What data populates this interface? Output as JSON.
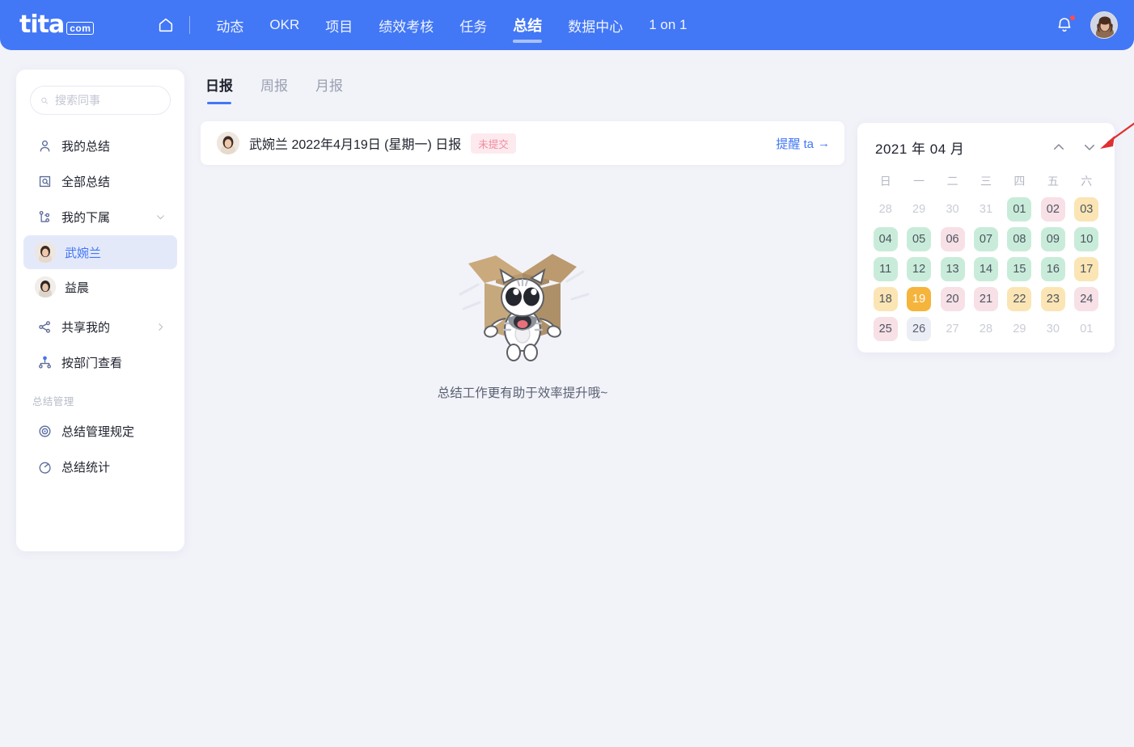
{
  "header": {
    "logo_word": "tita",
    "logo_com": "com",
    "home_icon": "home-icon",
    "bell_icon": "bell-icon",
    "avatar": "user-avatar",
    "nav": [
      {
        "label": "动态",
        "active": false
      },
      {
        "label": "OKR",
        "active": false
      },
      {
        "label": "项目",
        "active": false
      },
      {
        "label": "绩效考核",
        "active": false
      },
      {
        "label": "任务",
        "active": false
      },
      {
        "label": "总结",
        "active": true
      },
      {
        "label": "数据中心",
        "active": false
      },
      {
        "label": "1 on 1",
        "active": false
      }
    ],
    "accent_color": "#4277f6"
  },
  "sidebar": {
    "search": {
      "placeholder": "搜索同事",
      "value": "",
      "icon": "search-icon"
    },
    "items": [
      {
        "label": "我的总结",
        "icon": "user-icon",
        "caret": false
      },
      {
        "label": "全部总结",
        "icon": "document-search-icon",
        "caret": false
      },
      {
        "label": "我的下属",
        "icon": "org-subordinate-icon",
        "caret": "down"
      }
    ],
    "people": [
      {
        "name": "武婉兰",
        "selected": true
      },
      {
        "name": "益晨",
        "selected": false
      }
    ],
    "items2": [
      {
        "label": "共享我的",
        "icon": "share-icon",
        "caret": "right"
      },
      {
        "label": "按部门查看",
        "icon": "department-icon",
        "caret": false
      }
    ],
    "group_title": "总结管理",
    "items3": [
      {
        "label": "总结管理规定",
        "icon": "target-icon",
        "caret": false
      },
      {
        "label": "总结统计",
        "icon": "stats-clock-icon",
        "caret": false
      }
    ],
    "selected_color": "#e4e9fa"
  },
  "tabs": [
    {
      "label": "日报",
      "active": true
    },
    {
      "label": "周报",
      "active": false
    },
    {
      "label": "月报",
      "active": false
    }
  ],
  "report_card": {
    "avatar": "report-avatar",
    "title": "武婉兰 2022年4月19日 (星期一) 日报",
    "badge": "未提交",
    "badge_color": "#f08ba0",
    "remind_label": "提醒 ta",
    "remind_arrow": "→"
  },
  "empty_state": {
    "illustration": "cat-in-box-illustration",
    "text": "总结工作更有助于效率提升哦~"
  },
  "calendar": {
    "title": "2021 年 04 月",
    "prev_icon": "chevron-up-icon",
    "next_icon": "chevron-down-icon",
    "weekdays": [
      "日",
      "一",
      "二",
      "三",
      "四",
      "五",
      "六"
    ],
    "days": [
      {
        "d": "28",
        "state": "none"
      },
      {
        "d": "29",
        "state": "none"
      },
      {
        "d": "30",
        "state": "none"
      },
      {
        "d": "31",
        "state": "none"
      },
      {
        "d": "01",
        "state": "green"
      },
      {
        "d": "02",
        "state": "pink"
      },
      {
        "d": "03",
        "state": "yellow"
      },
      {
        "d": "04",
        "state": "green"
      },
      {
        "d": "05",
        "state": "green"
      },
      {
        "d": "06",
        "state": "pink"
      },
      {
        "d": "07",
        "state": "green"
      },
      {
        "d": "08",
        "state": "green"
      },
      {
        "d": "09",
        "state": "green"
      },
      {
        "d": "10",
        "state": "green"
      },
      {
        "d": "11",
        "state": "green"
      },
      {
        "d": "12",
        "state": "green"
      },
      {
        "d": "13",
        "state": "green"
      },
      {
        "d": "14",
        "state": "green"
      },
      {
        "d": "15",
        "state": "green"
      },
      {
        "d": "16",
        "state": "green"
      },
      {
        "d": "17",
        "state": "yellow"
      },
      {
        "d": "18",
        "state": "yellow"
      },
      {
        "d": "19",
        "state": "today"
      },
      {
        "d": "20",
        "state": "pink"
      },
      {
        "d": "21",
        "state": "pink"
      },
      {
        "d": "22",
        "state": "yellow"
      },
      {
        "d": "23",
        "state": "yellow"
      },
      {
        "d": "24",
        "state": "pink"
      },
      {
        "d": "25",
        "state": "pink"
      },
      {
        "d": "26",
        "state": "gray"
      },
      {
        "d": "27",
        "state": "none"
      },
      {
        "d": "28",
        "state": "none"
      },
      {
        "d": "29",
        "state": "none"
      },
      {
        "d": "30",
        "state": "none"
      },
      {
        "d": "01",
        "state": "none"
      }
    ]
  },
  "annotation": {
    "arrow": "red-annotation-arrow",
    "color": "#e03030"
  }
}
